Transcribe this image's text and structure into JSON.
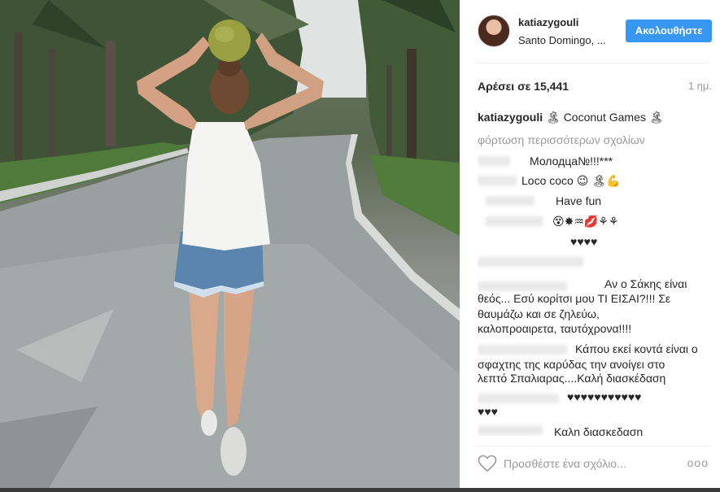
{
  "post": {
    "username": "katiazygouli",
    "location": "Santo Domingo, ...",
    "follow_label": "Ακολουθήστε",
    "likes": "Αρέσει σε 15,441",
    "time": "1 ημ."
  },
  "caption": {
    "user": "katiazygouli",
    "text": "🏝 Coconut Games 🏝"
  },
  "load_more": "φόρτωση περισσότερων σχολίων",
  "comments": [
    "Молодца№!!!***",
    "Loco coco 😉 🏝💪",
    "Have fun",
    "😵✸♒💋⚘⚘",
    "♥♥♥♥",
    "Αν ο Σάκης είναι",
    "θεός... Εσύ κορίτσι μου ΤΙ ΕΙΣΑΙ?!!! Σε",
    "θαυμάζω και σε ζηλεύω,",
    "καλοπροαιρετα, ταυτόχρονα!!!!",
    "Κάπου εκεί κοντά είναι ο",
    "σφαχτης της καρύδας την ανοίγει στο",
    "λεπτό Σπαλιαρας....Καλή διασκέδαση",
    "♥♥♥♥♥♥♥♥♥♥♥",
    "♥♥♥",
    "Καλη διασκεδαση"
  ],
  "add_comment": {
    "placeholder": "Προσθέστε ένα σχόλιο...",
    "more": "ooo"
  },
  "icons": {
    "heart": "heart-icon",
    "more": "more-options-icon"
  },
  "colors": {
    "follow_button": "#3897f0",
    "muted_text": "#999999"
  }
}
